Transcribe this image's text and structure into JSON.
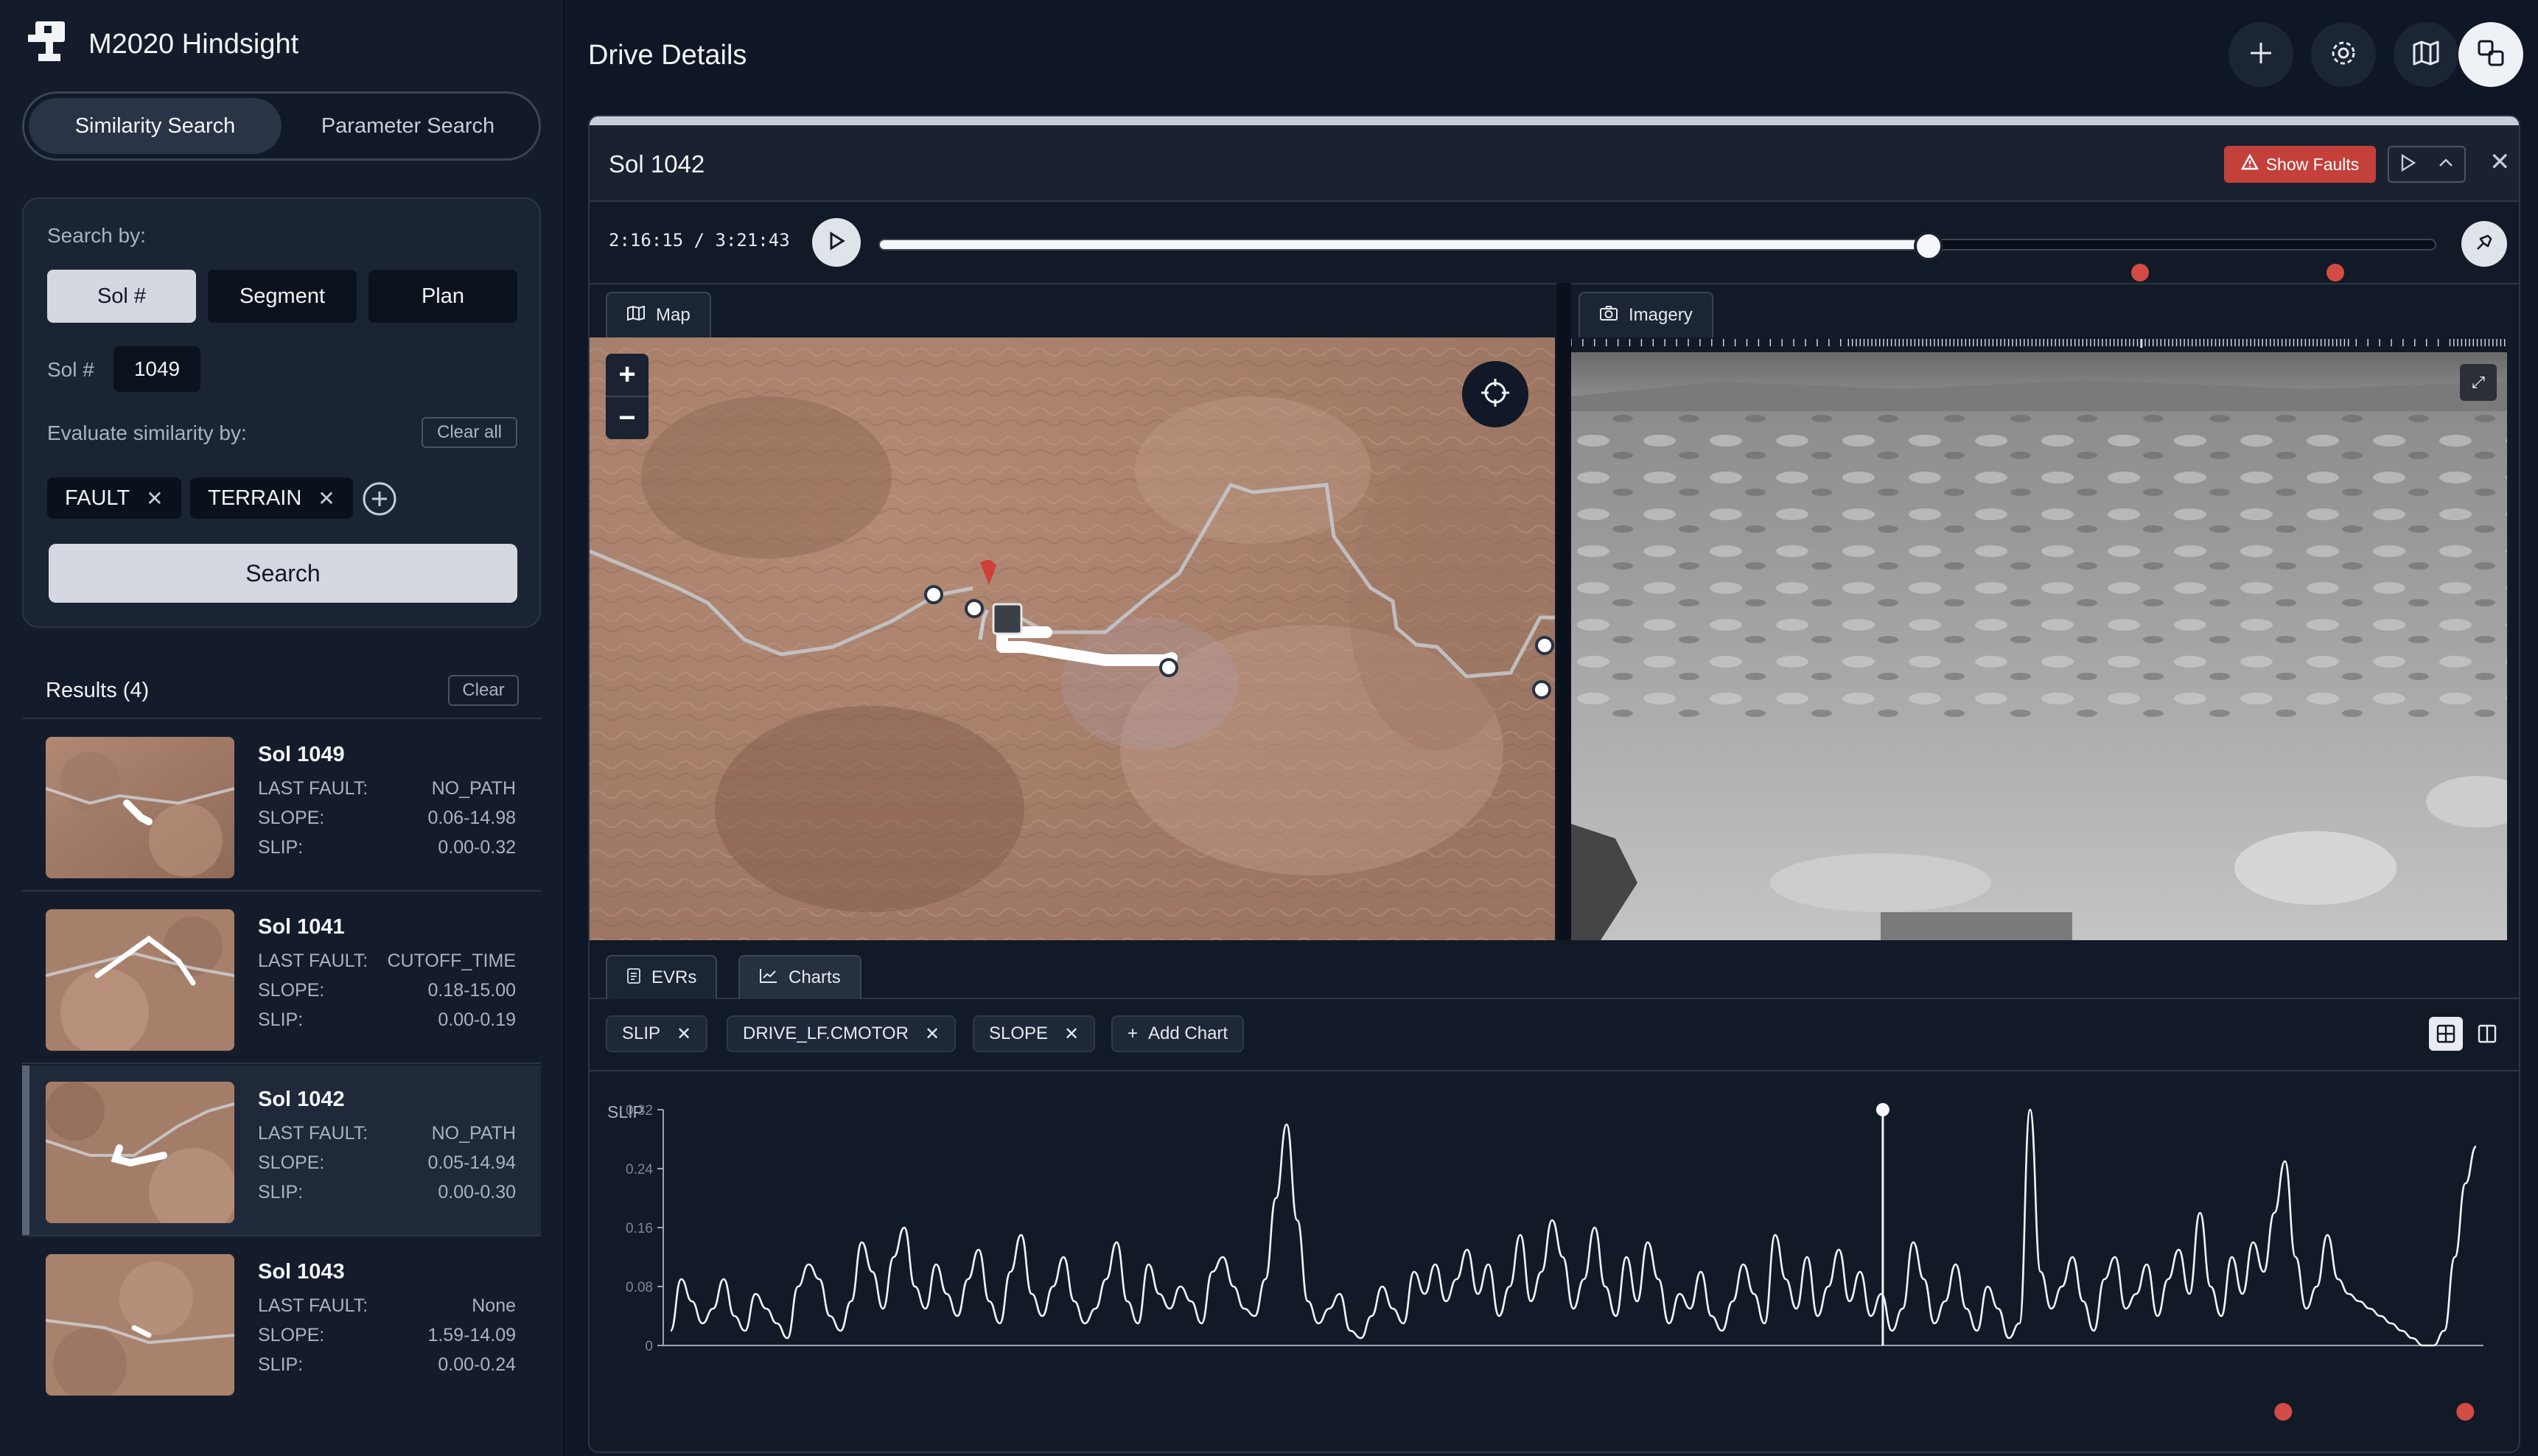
{
  "app": {
    "title": "M2020 Hindsight"
  },
  "search_mode": {
    "tabs": [
      "Similarity Search",
      "Parameter Search"
    ],
    "active": "Similarity Search"
  },
  "search_card": {
    "search_by_label": "Search by:",
    "options": [
      "Sol #",
      "Segment",
      "Plan"
    ],
    "active_option": "Sol #",
    "sol_label": "Sol #",
    "sol_value": "1049",
    "evaluate_label": "Evaluate similarity by:",
    "clear_all": "Clear all",
    "criteria": [
      "FAULT",
      "TERRAIN"
    ],
    "search_button": "Search"
  },
  "results": {
    "title": "Results (4)",
    "clear": "Clear",
    "labels": {
      "fault": "LAST FAULT:",
      "slope": "SLOPE:",
      "slip": "SLIP:"
    },
    "items": [
      {
        "title": "Sol 1049",
        "fault": "NO_PATH",
        "slope": "0.06-14.98",
        "slip": "0.00-0.32"
      },
      {
        "title": "Sol 1041",
        "fault": "CUTOFF_TIME",
        "slope": "0.18-15.00",
        "slip": "0.00-0.19"
      },
      {
        "title": "Sol 1042",
        "fault": "NO_PATH",
        "slope": "0.05-14.94",
        "slip": "0.00-0.30"
      },
      {
        "title": "Sol 1043",
        "fault": "None",
        "slope": "1.59-14.09",
        "slip": "0.00-0.24"
      }
    ],
    "selected_index": 2
  },
  "header": {
    "title": "Drive Details",
    "icons": [
      "plus-icon",
      "gear-icon",
      "map-icon",
      "copy-icon"
    ]
  },
  "drive": {
    "title": "Sol 1042",
    "show_faults": "Show Faults",
    "timecode": "2:16:15 / 3:21:43",
    "progress": 0.673,
    "fault_markers": [
      0.81,
      0.935
    ]
  },
  "views": {
    "map_tab": "Map",
    "imagery_tab": "Imagery"
  },
  "bottom_tabs": {
    "evrs": "EVRs",
    "charts": "Charts"
  },
  "charts": {
    "chips": [
      "SLIP",
      "DRIVE_LF.CMOTOR",
      "SLOPE"
    ],
    "add_chart": "Add Chart",
    "panel_label": "SLIP"
  },
  "colors": {
    "fault": "#d34b45",
    "accent": "#c4403a"
  },
  "chart_data": {
    "type": "line",
    "ylabel": "SLIP",
    "ylim": [
      0,
      0.32
    ],
    "yticks": [
      "0",
      "0.08",
      "0.16",
      "0.24",
      "0.32"
    ],
    "cursor": 0.67,
    "fault_markers": [
      0.89,
      0.99
    ],
    "series": [
      {
        "values": [
          0.02,
          0.09,
          0.06,
          0.03,
          0.05,
          0.09,
          0.04,
          0.02,
          0.07,
          0.05,
          0.03,
          0.01,
          0.08,
          0.11,
          0.09,
          0.04,
          0.02,
          0.06,
          0.14,
          0.1,
          0.05,
          0.12,
          0.16,
          0.08,
          0.05,
          0.11,
          0.07,
          0.04,
          0.09,
          0.13,
          0.06,
          0.03,
          0.1,
          0.15,
          0.07,
          0.04,
          0.08,
          0.12,
          0.06,
          0.03,
          0.05,
          0.09,
          0.14,
          0.06,
          0.03,
          0.11,
          0.07,
          0.05,
          0.08,
          0.06,
          0.03,
          0.1,
          0.12,
          0.08,
          0.05,
          0.04,
          0.09,
          0.2,
          0.3,
          0.17,
          0.06,
          0.03,
          0.05,
          0.07,
          0.02,
          0.01,
          0.04,
          0.08,
          0.05,
          0.03,
          0.1,
          0.07,
          0.11,
          0.06,
          0.09,
          0.13,
          0.07,
          0.11,
          0.04,
          0.08,
          0.15,
          0.06,
          0.1,
          0.17,
          0.12,
          0.05,
          0.09,
          0.16,
          0.08,
          0.04,
          0.12,
          0.06,
          0.14,
          0.09,
          0.03,
          0.07,
          0.05,
          0.1,
          0.04,
          0.02,
          0.06,
          0.11,
          0.07,
          0.03,
          0.15,
          0.09,
          0.05,
          0.12,
          0.04,
          0.08,
          0.13,
          0.06,
          0.1,
          0.04,
          0.07,
          0.02,
          0.05,
          0.14,
          0.09,
          0.03,
          0.06,
          0.11,
          0.05,
          0.02,
          0.08,
          0.05,
          0.01,
          0.03,
          0.32,
          0.1,
          0.05,
          0.08,
          0.12,
          0.06,
          0.02,
          0.09,
          0.12,
          0.05,
          0.07,
          0.11,
          0.04,
          0.09,
          0.13,
          0.07,
          0.18,
          0.08,
          0.04,
          0.12,
          0.07,
          0.14,
          0.1,
          0.18,
          0.25,
          0.12,
          0.05,
          0.08,
          0.15,
          0.09,
          0.07,
          0.06,
          0.05,
          0.04,
          0.03,
          0.02,
          0.01,
          0.0,
          0.0,
          0.02,
          0.12,
          0.22,
          0.27
        ]
      }
    ]
  }
}
